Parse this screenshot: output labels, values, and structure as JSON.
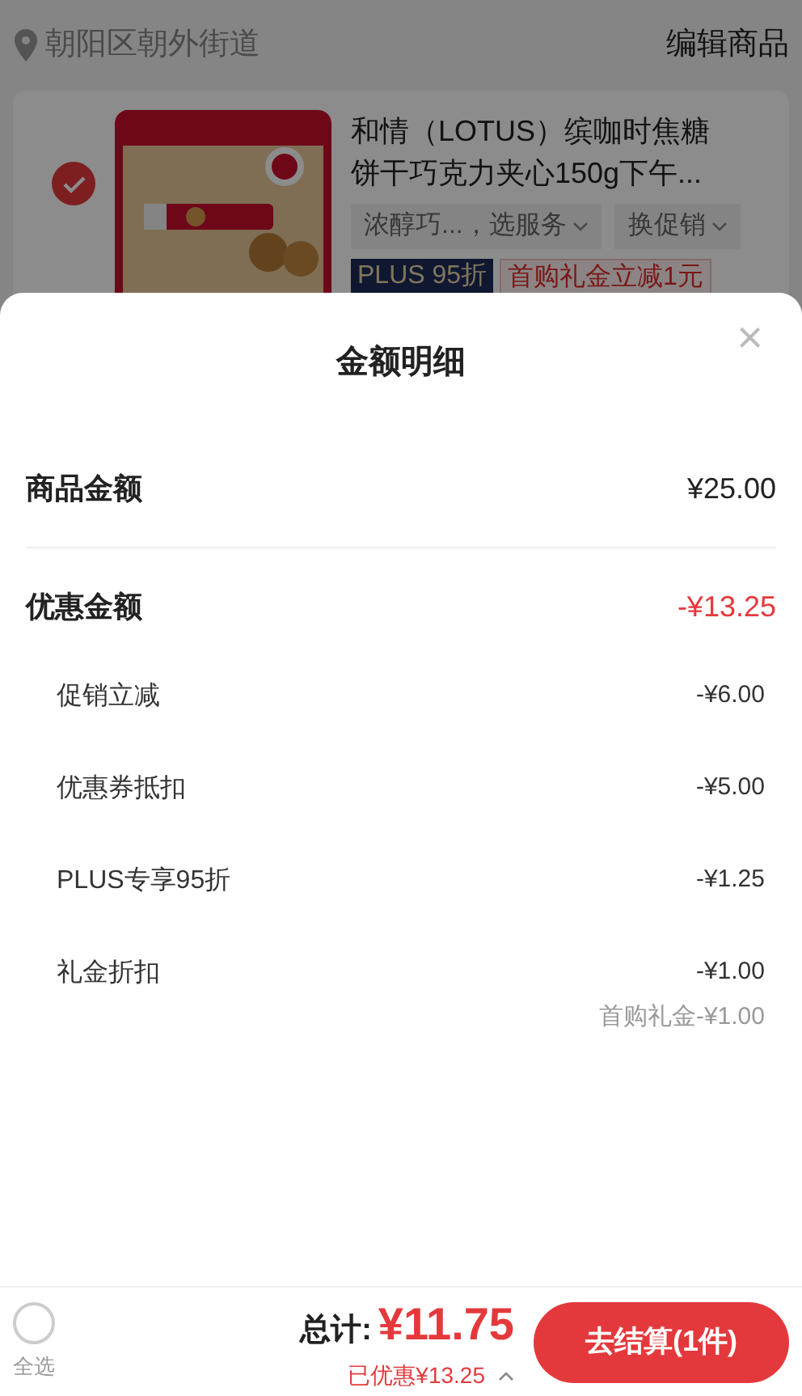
{
  "header": {
    "location": "朝阳区朝外街道",
    "edit_button": "编辑商品"
  },
  "cart_item": {
    "selected": true,
    "title": "和情（LOTUS）缤咖时焦糖饼干巧克力夹心150g下午...",
    "spec": "浓醇巧...，选服务",
    "promo_select": "换促销",
    "tags": [
      {
        "kind": "plus",
        "label": "PLUS 95折"
      },
      {
        "kind": "coupon",
        "label": "首购礼金立减1元"
      }
    ]
  },
  "sheet": {
    "title": "金额明细",
    "close": "×",
    "rows": [
      {
        "kind": "main",
        "label": "商品金额",
        "value": "¥25.00",
        "discount": false
      },
      {
        "kind": "main",
        "label": "优惠金额",
        "value": "-¥13.25",
        "discount": true
      },
      {
        "kind": "sub",
        "label": "促销立减",
        "value": "-¥6.00"
      },
      {
        "kind": "sub",
        "label": "优惠券抵扣",
        "value": "-¥5.00"
      },
      {
        "kind": "sub",
        "label": "PLUS专享95折",
        "value": "-¥1.25"
      },
      {
        "kind": "sub",
        "label": "礼金折扣",
        "value": "-¥1.00",
        "note": "首购礼金-¥1.00"
      }
    ]
  },
  "footer": {
    "select_all": {
      "label": "全选",
      "checked": false
    },
    "total_label": "总计:",
    "total": "¥11.75",
    "saved": "已优惠¥13.25",
    "checkout": "去结算(1件)"
  }
}
